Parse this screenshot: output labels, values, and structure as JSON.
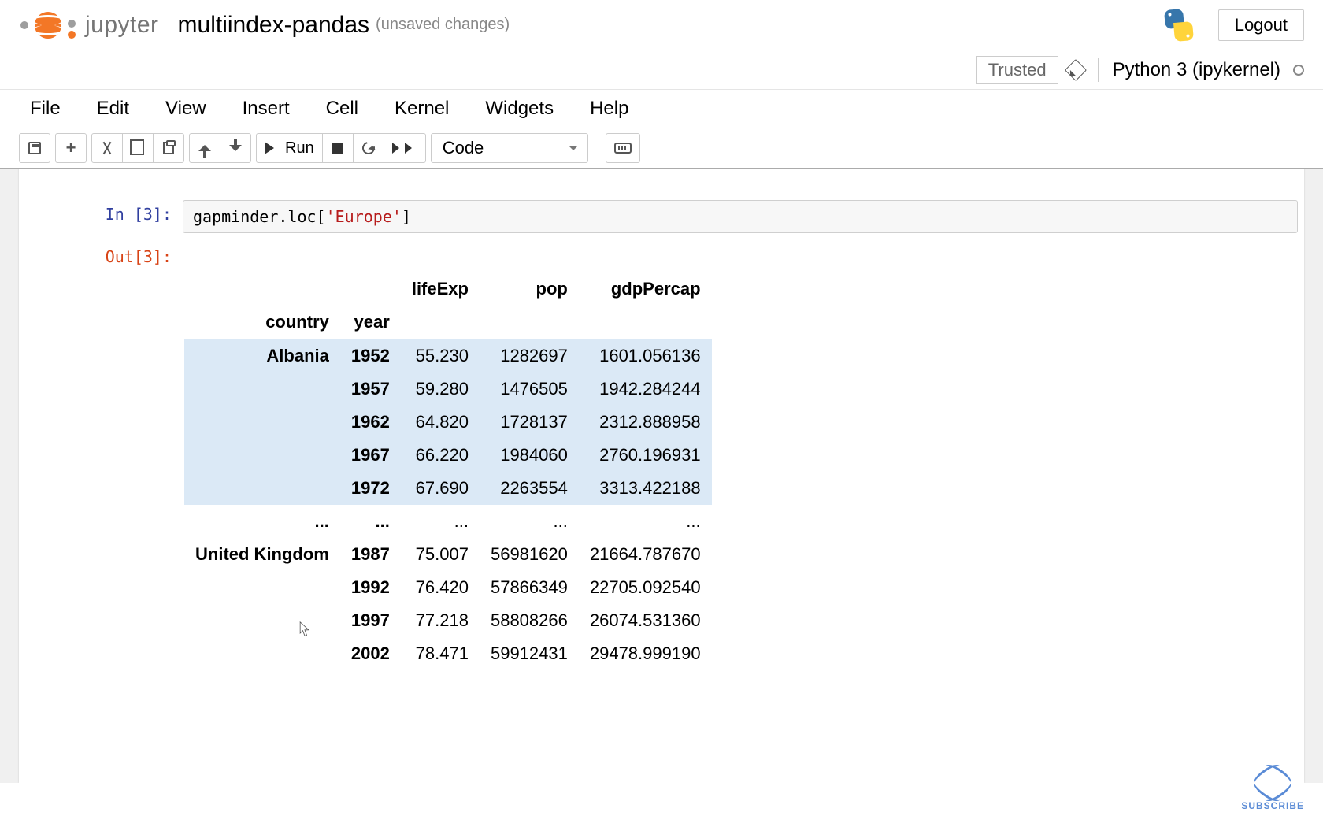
{
  "header": {
    "logo_text": "jupyter",
    "notebook_title": "multiindex-pandas",
    "subtitle": "(unsaved changes)",
    "logout_label": "Logout"
  },
  "status": {
    "trusted_label": "Trusted",
    "kernel_name": "Python 3 (ipykernel)"
  },
  "menu": {
    "items": [
      "File",
      "Edit",
      "View",
      "Insert",
      "Cell",
      "Kernel",
      "Widgets",
      "Help"
    ]
  },
  "toolbar": {
    "run_label": "Run",
    "cell_type": "Code"
  },
  "cell": {
    "in_prompt": "In [3]:",
    "out_prompt": "Out[3]:",
    "code_prefix": "gapminder.loc[",
    "code_string": "'Europe'",
    "code_suffix": "]"
  },
  "table": {
    "columns": [
      "lifeExp",
      "pop",
      "gdpPercap"
    ],
    "index_names": [
      "country",
      "year"
    ],
    "rows": [
      {
        "country": "Albania",
        "year": "1952",
        "lifeExp": "55.230",
        "pop": "1282697",
        "gdpPercap": "1601.056136",
        "hl": true,
        "show_country": true
      },
      {
        "country": "",
        "year": "1957",
        "lifeExp": "59.280",
        "pop": "1476505",
        "gdpPercap": "1942.284244",
        "hl": true,
        "show_country": false
      },
      {
        "country": "",
        "year": "1962",
        "lifeExp": "64.820",
        "pop": "1728137",
        "gdpPercap": "2312.888958",
        "hl": true,
        "show_country": false
      },
      {
        "country": "",
        "year": "1967",
        "lifeExp": "66.220",
        "pop": "1984060",
        "gdpPercap": "2760.196931",
        "hl": true,
        "show_country": false
      },
      {
        "country": "",
        "year": "1972",
        "lifeExp": "67.690",
        "pop": "2263554",
        "gdpPercap": "3313.422188",
        "hl": true,
        "show_country": false
      },
      {
        "country": "...",
        "year": "...",
        "lifeExp": "...",
        "pop": "...",
        "gdpPercap": "...",
        "hl": false,
        "show_country": true
      },
      {
        "country": "United Kingdom",
        "year": "1987",
        "lifeExp": "75.007",
        "pop": "56981620",
        "gdpPercap": "21664.787670",
        "hl": false,
        "show_country": true
      },
      {
        "country": "",
        "year": "1992",
        "lifeExp": "76.420",
        "pop": "57866349",
        "gdpPercap": "22705.092540",
        "hl": false,
        "show_country": false
      },
      {
        "country": "",
        "year": "1997",
        "lifeExp": "77.218",
        "pop": "58808266",
        "gdpPercap": "26074.531360",
        "hl": false,
        "show_country": false
      },
      {
        "country": "",
        "year": "2002",
        "lifeExp": "78.471",
        "pop": "59912431",
        "gdpPercap": "29478.999190",
        "hl": false,
        "show_country": false
      }
    ]
  },
  "subscribe": {
    "label": "SUBSCRIBE"
  }
}
